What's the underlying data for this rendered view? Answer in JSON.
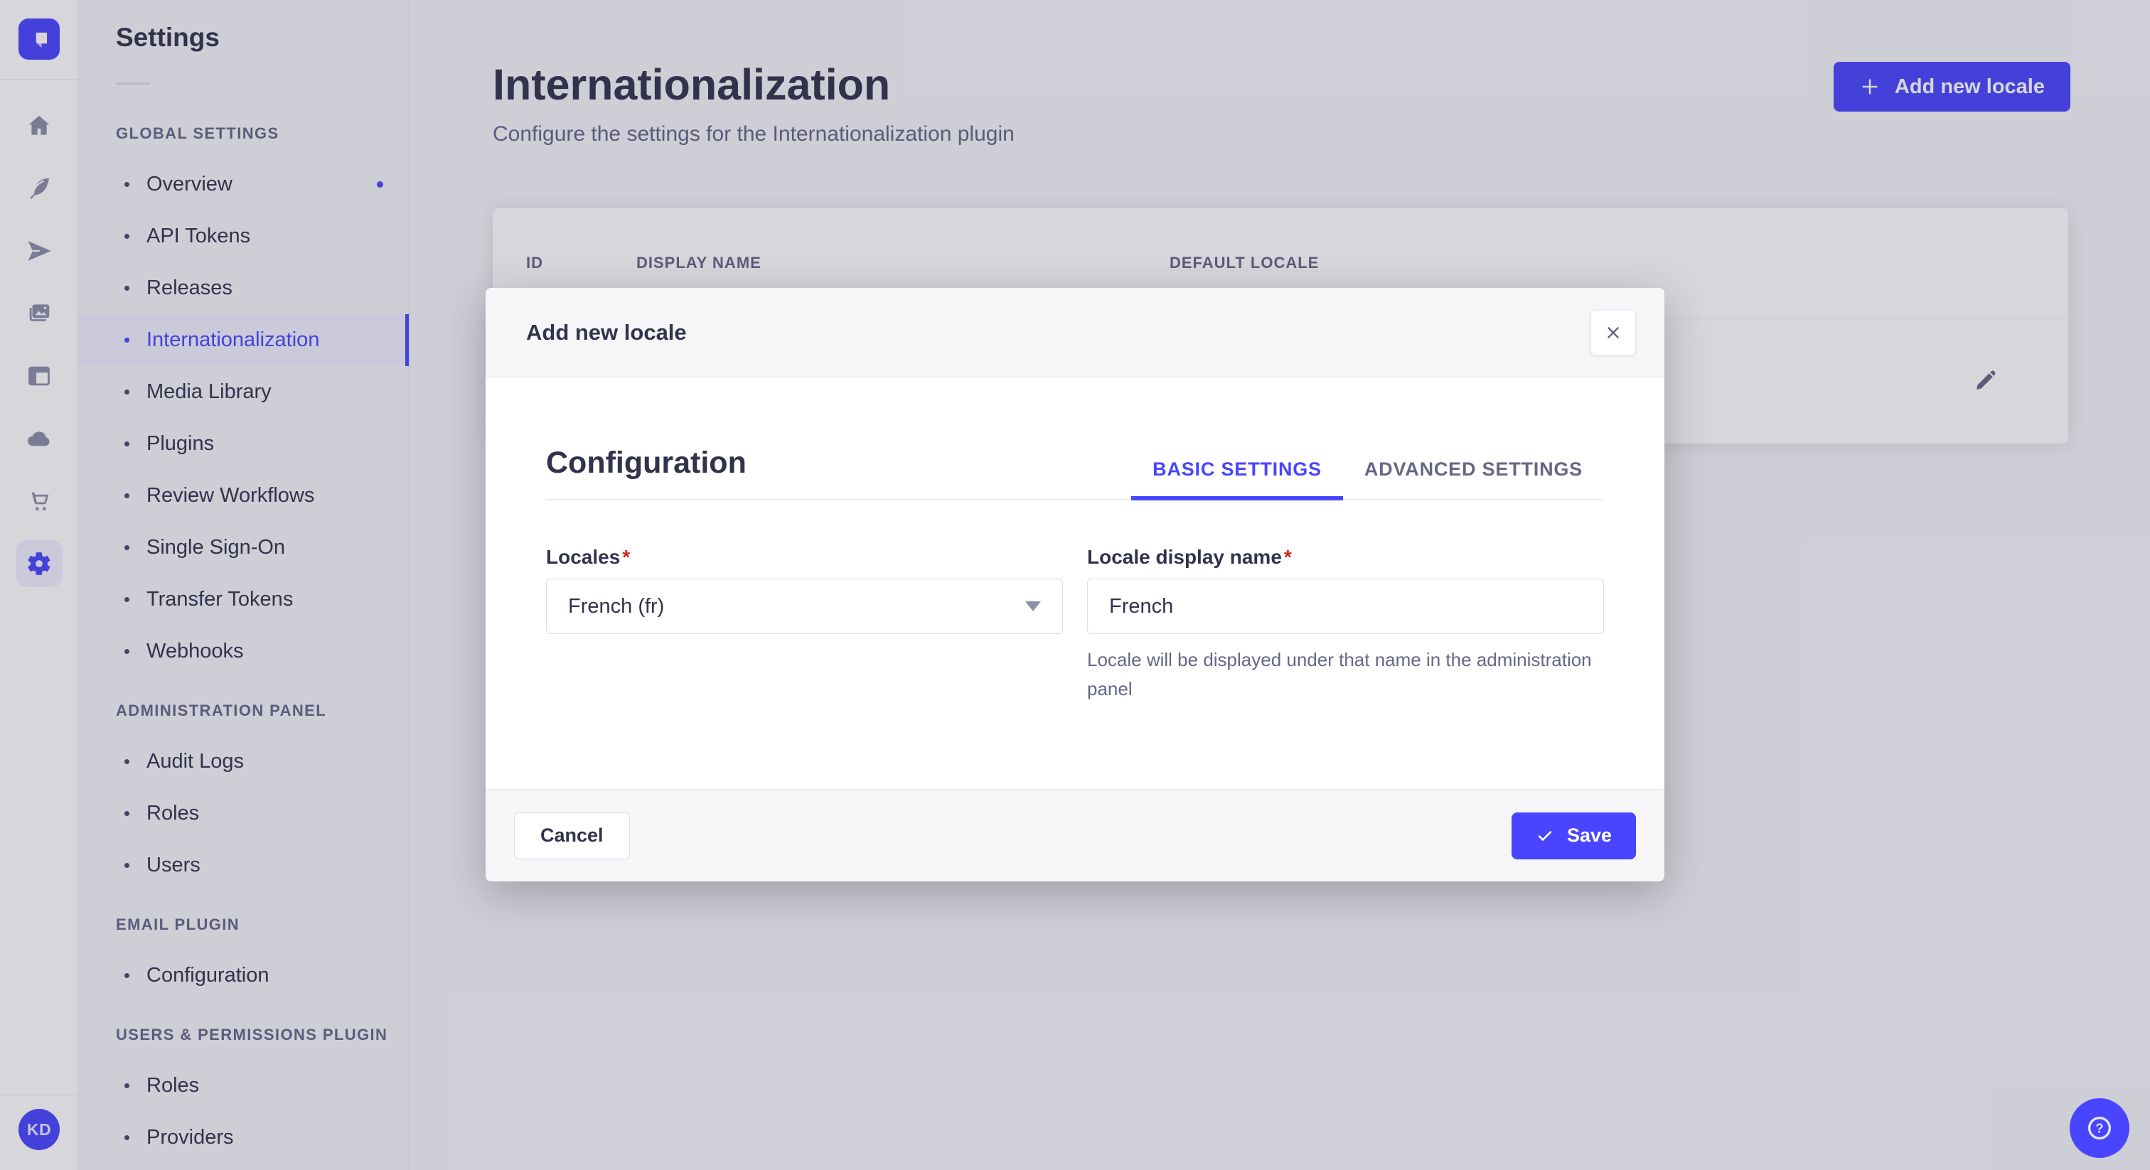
{
  "colors": {
    "accent": "#4945ff",
    "accent_light": "#f0f0ff",
    "danger_asterisk": "#d02b20",
    "text": "#32324d",
    "text_muted": "#666687",
    "surface_alt": "#f6f6f9",
    "overlay": "rgba(50,50,77,0.2)"
  },
  "rail": {
    "logo": "strapi-logo",
    "icons": [
      "home-icon",
      "feather-icon",
      "paper-plane-icon",
      "images-icon",
      "layout-icon",
      "cloud-icon",
      "cart-icon",
      "gear-icon"
    ]
  },
  "sidebar": {
    "title": "Settings",
    "sections": [
      {
        "label": "GLOBAL SETTINGS",
        "items": [
          {
            "label": "Overview",
            "badge_dot": true
          },
          {
            "label": "API Tokens"
          },
          {
            "label": "Releases"
          },
          {
            "label": "Internationalization",
            "active": true
          },
          {
            "label": "Media Library"
          },
          {
            "label": "Plugins"
          },
          {
            "label": "Review Workflows"
          },
          {
            "label": "Single Sign-On"
          },
          {
            "label": "Transfer Tokens"
          },
          {
            "label": "Webhooks"
          }
        ]
      },
      {
        "label": "ADMINISTRATION PANEL",
        "items": [
          {
            "label": "Audit Logs"
          },
          {
            "label": "Roles"
          },
          {
            "label": "Users"
          }
        ]
      },
      {
        "label": "EMAIL PLUGIN",
        "items": [
          {
            "label": "Configuration"
          }
        ]
      },
      {
        "label": "USERS & PERMISSIONS PLUGIN",
        "items": [
          {
            "label": "Roles"
          },
          {
            "label": "Providers"
          }
        ]
      }
    ]
  },
  "page": {
    "title": "Internationalization",
    "subtitle": "Configure the settings for the Internationalization plugin",
    "add_button": "Add new locale"
  },
  "table": {
    "columns": [
      "ID",
      "DISPLAY NAME",
      "DEFAULT LOCALE"
    ]
  },
  "modal": {
    "title": "Add new locale",
    "section_title": "Configuration",
    "required_mark": "*",
    "tabs": [
      {
        "label": "BASIC SETTINGS",
        "active": true
      },
      {
        "label": "ADVANCED SETTINGS",
        "active": false
      }
    ],
    "fields": {
      "locales": {
        "label": "Locales",
        "value": "French (fr)"
      },
      "display_name": {
        "label": "Locale display name",
        "value": "French",
        "hint": "Locale will be displayed under that name in the administration panel"
      }
    },
    "cancel_label": "Cancel",
    "save_label": "Save"
  },
  "user": {
    "initials": "KD"
  },
  "help": {
    "glyph": "?"
  }
}
